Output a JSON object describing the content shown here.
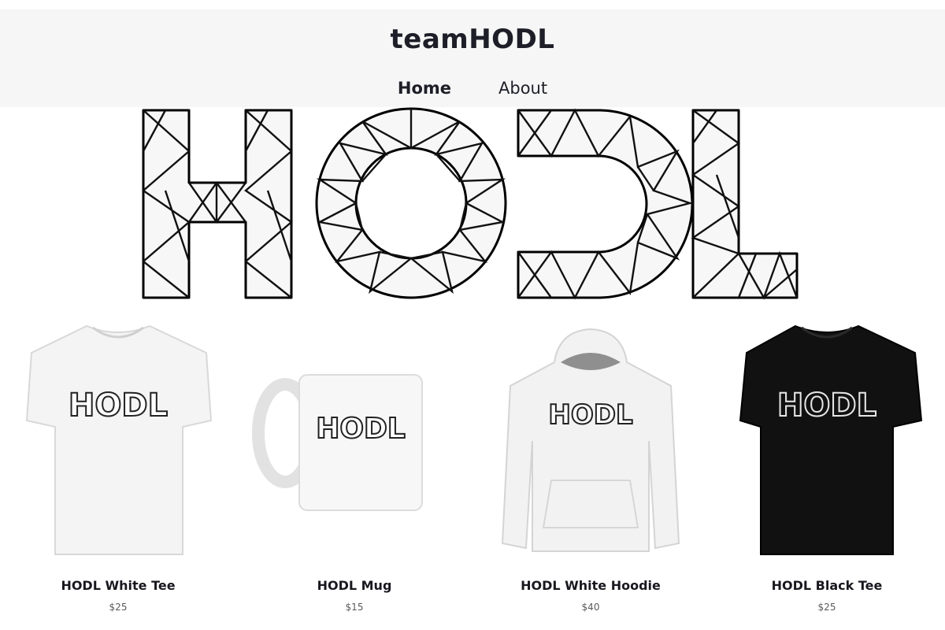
{
  "header": {
    "site_title": "teamHODL",
    "nav": [
      {
        "label": "Home",
        "active": true
      },
      {
        "label": "About",
        "active": false
      }
    ]
  },
  "hero": {
    "logo_text": "HODL"
  },
  "products": [
    {
      "name": "HODL White Tee",
      "price": "$25",
      "print": "HODL",
      "garment_color": "#f4f4f4"
    },
    {
      "name": "HODL Mug",
      "price": "$15",
      "print": "HODL",
      "garment_color": "#f7f7f7"
    },
    {
      "name": "HODL White Hoodie",
      "price": "$40",
      "print": "HODL",
      "garment_color": "#f2f2f2"
    },
    {
      "name": "HODL Black Tee",
      "price": "$25",
      "print": "HODL",
      "garment_color": "#111111"
    }
  ]
}
